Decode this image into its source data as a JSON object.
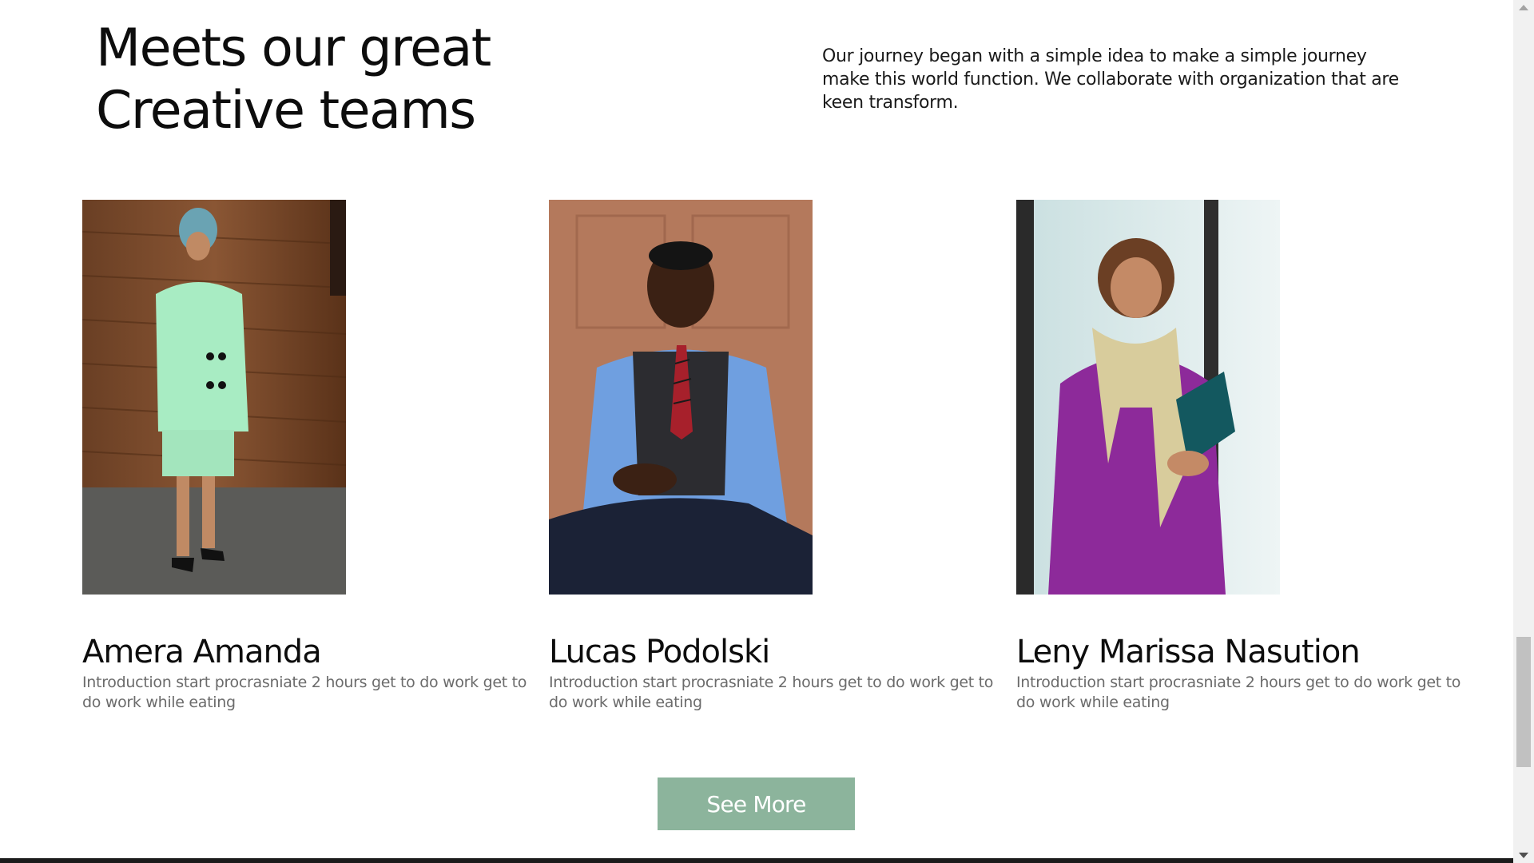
{
  "section": {
    "heading_line1": "Meets our great",
    "heading_line2": "Creative teams",
    "intro": "Our journey began with a simple idea to make a simple journey make this world function. We collaborate with organization that are keen transform."
  },
  "team": [
    {
      "name": "Amera Amanda",
      "description": "Introduction start procrasniate 2 hours get to do work get to do work while eating",
      "photo": "woman-mint-suit-photo"
    },
    {
      "name": "Lucas Podolski",
      "description": "Introduction start procrasniate 2 hours get to do work get to do work while eating",
      "photo": "man-vest-tie-photo"
    },
    {
      "name": "Leny Marissa Nasution",
      "description": "Introduction start procrasniate 2 hours get to do work get to do work while eating",
      "photo": "woman-purple-dress-photo"
    }
  ],
  "button": {
    "see_more_label": "See More"
  },
  "colors": {
    "button_bg": "#8cb49c",
    "heading": "#0d0d0d",
    "description": "#6b6b6b"
  },
  "scrollbar": {
    "position_fraction": 0.78
  }
}
